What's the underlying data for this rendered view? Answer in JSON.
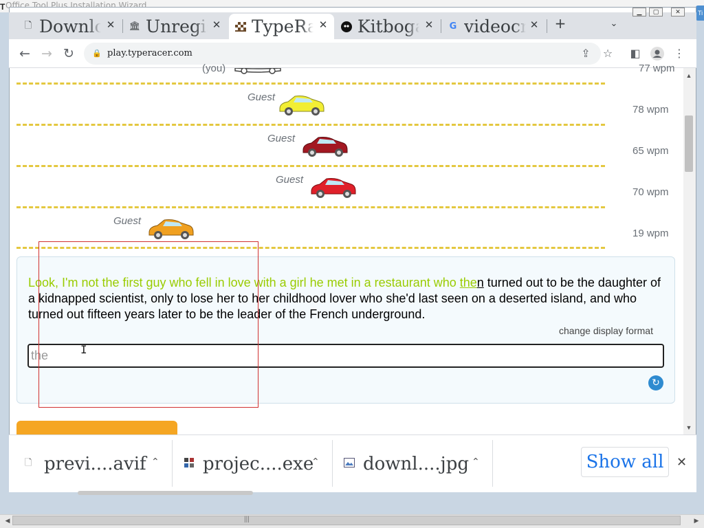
{
  "outer_window": {
    "title": "Office Tool Plus Installation Wizard",
    "sys_icon": "T",
    "right_tip": "Ti"
  },
  "tabs": [
    {
      "label": "Downloads",
      "favicon": "file-icon"
    },
    {
      "label": "Unregistered",
      "favicon": "museum-icon"
    },
    {
      "label": "TypeRacer",
      "favicon": "typeracer-flag-icon",
      "active": true
    },
    {
      "label": "Kitboga",
      "favicon": "kitboga-icon"
    },
    {
      "label": "videocrypt",
      "favicon": "google-icon"
    }
  ],
  "toolbar": {
    "url": "play.typeracer.com"
  },
  "race": {
    "top_lane_label": "(you)",
    "top_lane_wpm": "77 wpm",
    "lanes": [
      {
        "name": "Guest",
        "wpm": "78 wpm",
        "car_color": "#f2ee34"
      },
      {
        "name": "Guest",
        "wpm": "65 wpm",
        "car_color": "#a31822"
      },
      {
        "name": "Guest",
        "wpm": "70 wpm",
        "car_color": "#e0202a"
      },
      {
        "name": "Guest",
        "wpm": "19 wpm",
        "car_color": "#f0a020"
      }
    ],
    "passage": {
      "typed": "Look, I'm not the first guy who fell in love with a girl he met in a restaurant who ",
      "current_typed": "the",
      "current_rest": "n",
      "remaining": " turned out to be the daughter of a kidnapped scientist, only to lose her to her childhood lover who she'd last seen on a deserted island, and who turned out fifteen years later to be the leader of the French underground."
    },
    "change_display_format": "change display format",
    "input_value": "the"
  },
  "downloads": [
    {
      "name": "previ....avif",
      "icon": "file-icon"
    },
    {
      "name": "projec....exe",
      "icon": "exe-icon"
    },
    {
      "name": "downl....jpg",
      "icon": "image-icon"
    }
  ],
  "show_all": "Show all",
  "colors": {
    "typed_text": "#99cc00",
    "lane_dash": "#e4c840",
    "show_all": "#1a73e8",
    "refresh": "#2f8bd0"
  }
}
